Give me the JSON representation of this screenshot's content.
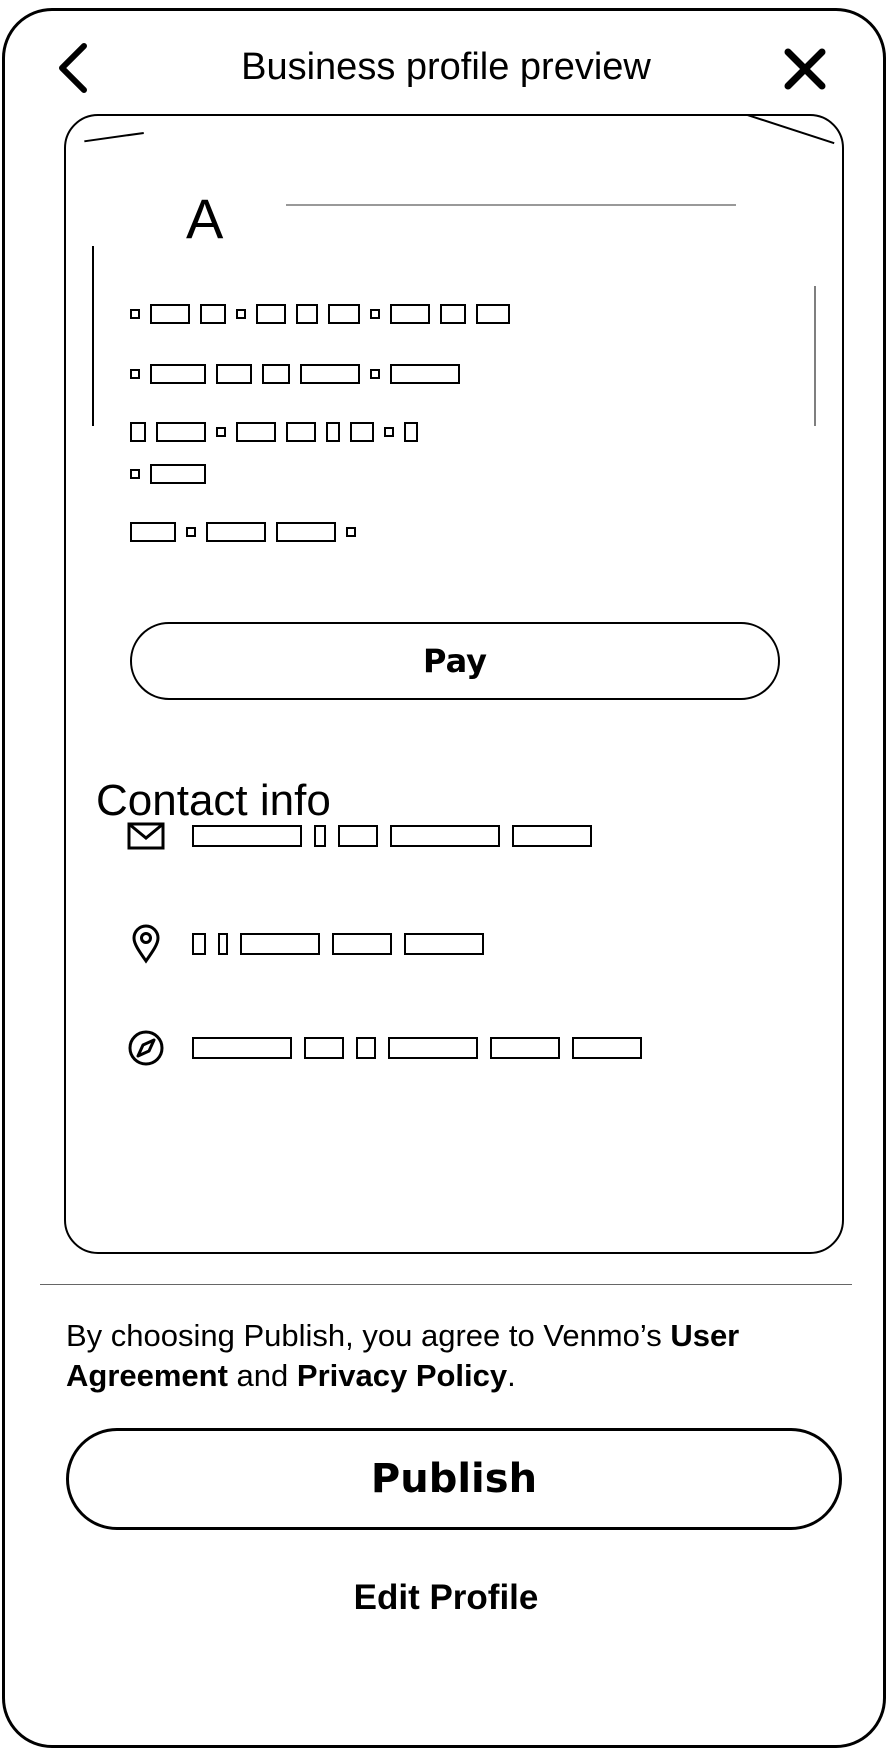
{
  "header": {
    "title": "Business profile preview",
    "back_icon": "chevron-left-icon",
    "close_icon": "close-icon"
  },
  "profile": {
    "avatar_letter": "A"
  },
  "actions": {
    "pay_label": "Pay"
  },
  "contact": {
    "title": "Contact info",
    "items": [
      {
        "icon": "mail-icon"
      },
      {
        "icon": "location-pin-icon"
      },
      {
        "icon": "compass-icon"
      }
    ]
  },
  "footer": {
    "legal_prefix": "By choosing Publish, you agree to Venmo’s ",
    "user_agreement": "User Agreement",
    "legal_and": " and ",
    "privacy_policy": "Privacy Policy",
    "legal_suffix": ".",
    "publish_label": "Publish",
    "edit_label": "Edit Profile"
  }
}
